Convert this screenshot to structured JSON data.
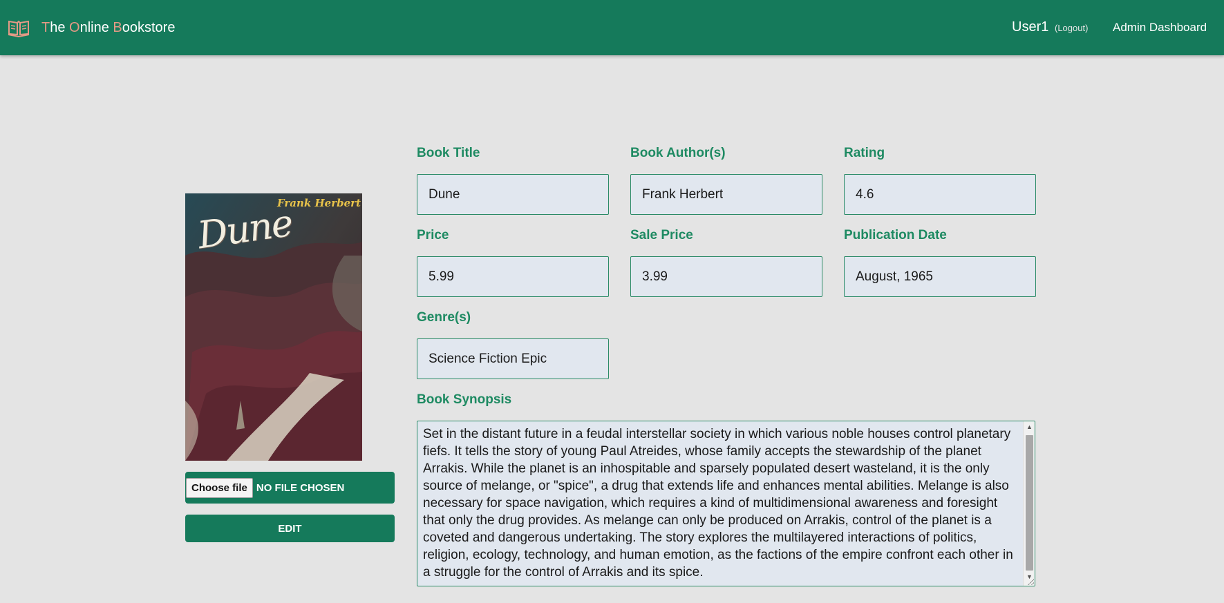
{
  "navbar": {
    "brand": {
      "letters": [
        "T",
        "he ",
        "O",
        "nline ",
        "B",
        "ookstore"
      ]
    },
    "user": "User1",
    "logout": "(Logout)",
    "admin_link": "Admin Dashboard",
    "colors": {
      "background": "#157a5b",
      "brand_accent": "#e59a86"
    }
  },
  "book": {
    "cover": {
      "author_text": "Frank Herbert",
      "title_text": "Dune"
    },
    "file_button": "Choose file",
    "file_status": "No file chosen",
    "edit_button": "Edit"
  },
  "form": {
    "labels": {
      "title": "Book Title",
      "authors": "Book Author(s)",
      "rating": "Rating",
      "price": "Price",
      "sale_price": "Sale Price",
      "publication_date": "Publication Date",
      "genres": "Genre(s)",
      "synopsis": "Book Synopsis"
    },
    "values": {
      "title": "Dune",
      "authors": "Frank Herbert",
      "rating": "4.6",
      "price": "5.99",
      "sale_price": "3.99",
      "publication_date": "August, 1965",
      "genres": "Science Fiction Epic",
      "synopsis": "Set in the distant future in a feudal interstellar society in which various noble houses control planetary fiefs. It tells the story of young Paul Atreides, whose family accepts the stewardship of the planet Arrakis. While the planet is an inhospitable and sparsely populated desert wasteland, it is the only source of melange, or \"spice\", a drug that extends life and enhances mental abilities. Melange is also necessary for space navigation, which requires a kind of multidimensional awareness and foresight that only the drug provides. As melange can only be produced on Arrakis, control of the planet is a coveted and dangerous undertaking. The story explores the multilayered interactions of politics, religion, ecology, technology, and human emotion, as the factions of the empire confront each other in a struggle for the control of Arrakis and its spice."
    },
    "colors": {
      "label": "#1e8a62",
      "input_bg": "#e1e7ef",
      "input_border": "#2a8a66",
      "button": "#157a5b"
    }
  }
}
